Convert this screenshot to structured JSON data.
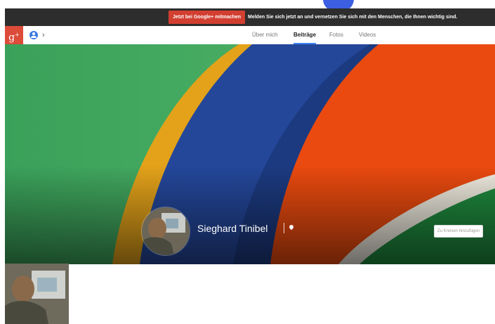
{
  "promo": {
    "join_button": "Jetzt bei Google+ mitmachen",
    "message": "Melden Sie sich jetzt an und vernetzen Sie sich mit den Menschen, die Ihnen wichtig sind."
  },
  "nav": {
    "logo": "g+",
    "tabs": [
      {
        "label": "Über mich",
        "active": false
      },
      {
        "label": "Beiträge",
        "active": true
      },
      {
        "label": "Fotos",
        "active": false
      },
      {
        "label": "Videos",
        "active": false
      }
    ]
  },
  "profile": {
    "name": "Sieghard Tinibel",
    "add_to_circles": "Zu Kreisen hinzufügen"
  },
  "colors": {
    "brand_red": "#dd4b39",
    "promo_bar": "#2d2d2d",
    "active_tab_underline": "#4285f4",
    "cover_green": "#3fa85c",
    "cover_yellow": "#e6a71c",
    "cover_blue": "#24489c",
    "cover_orange": "#ec4d10"
  },
  "icons": {
    "logo": "google-plus-icon",
    "user": "user-icon",
    "chevron": "chevron-right-icon",
    "location": "location-icon"
  }
}
